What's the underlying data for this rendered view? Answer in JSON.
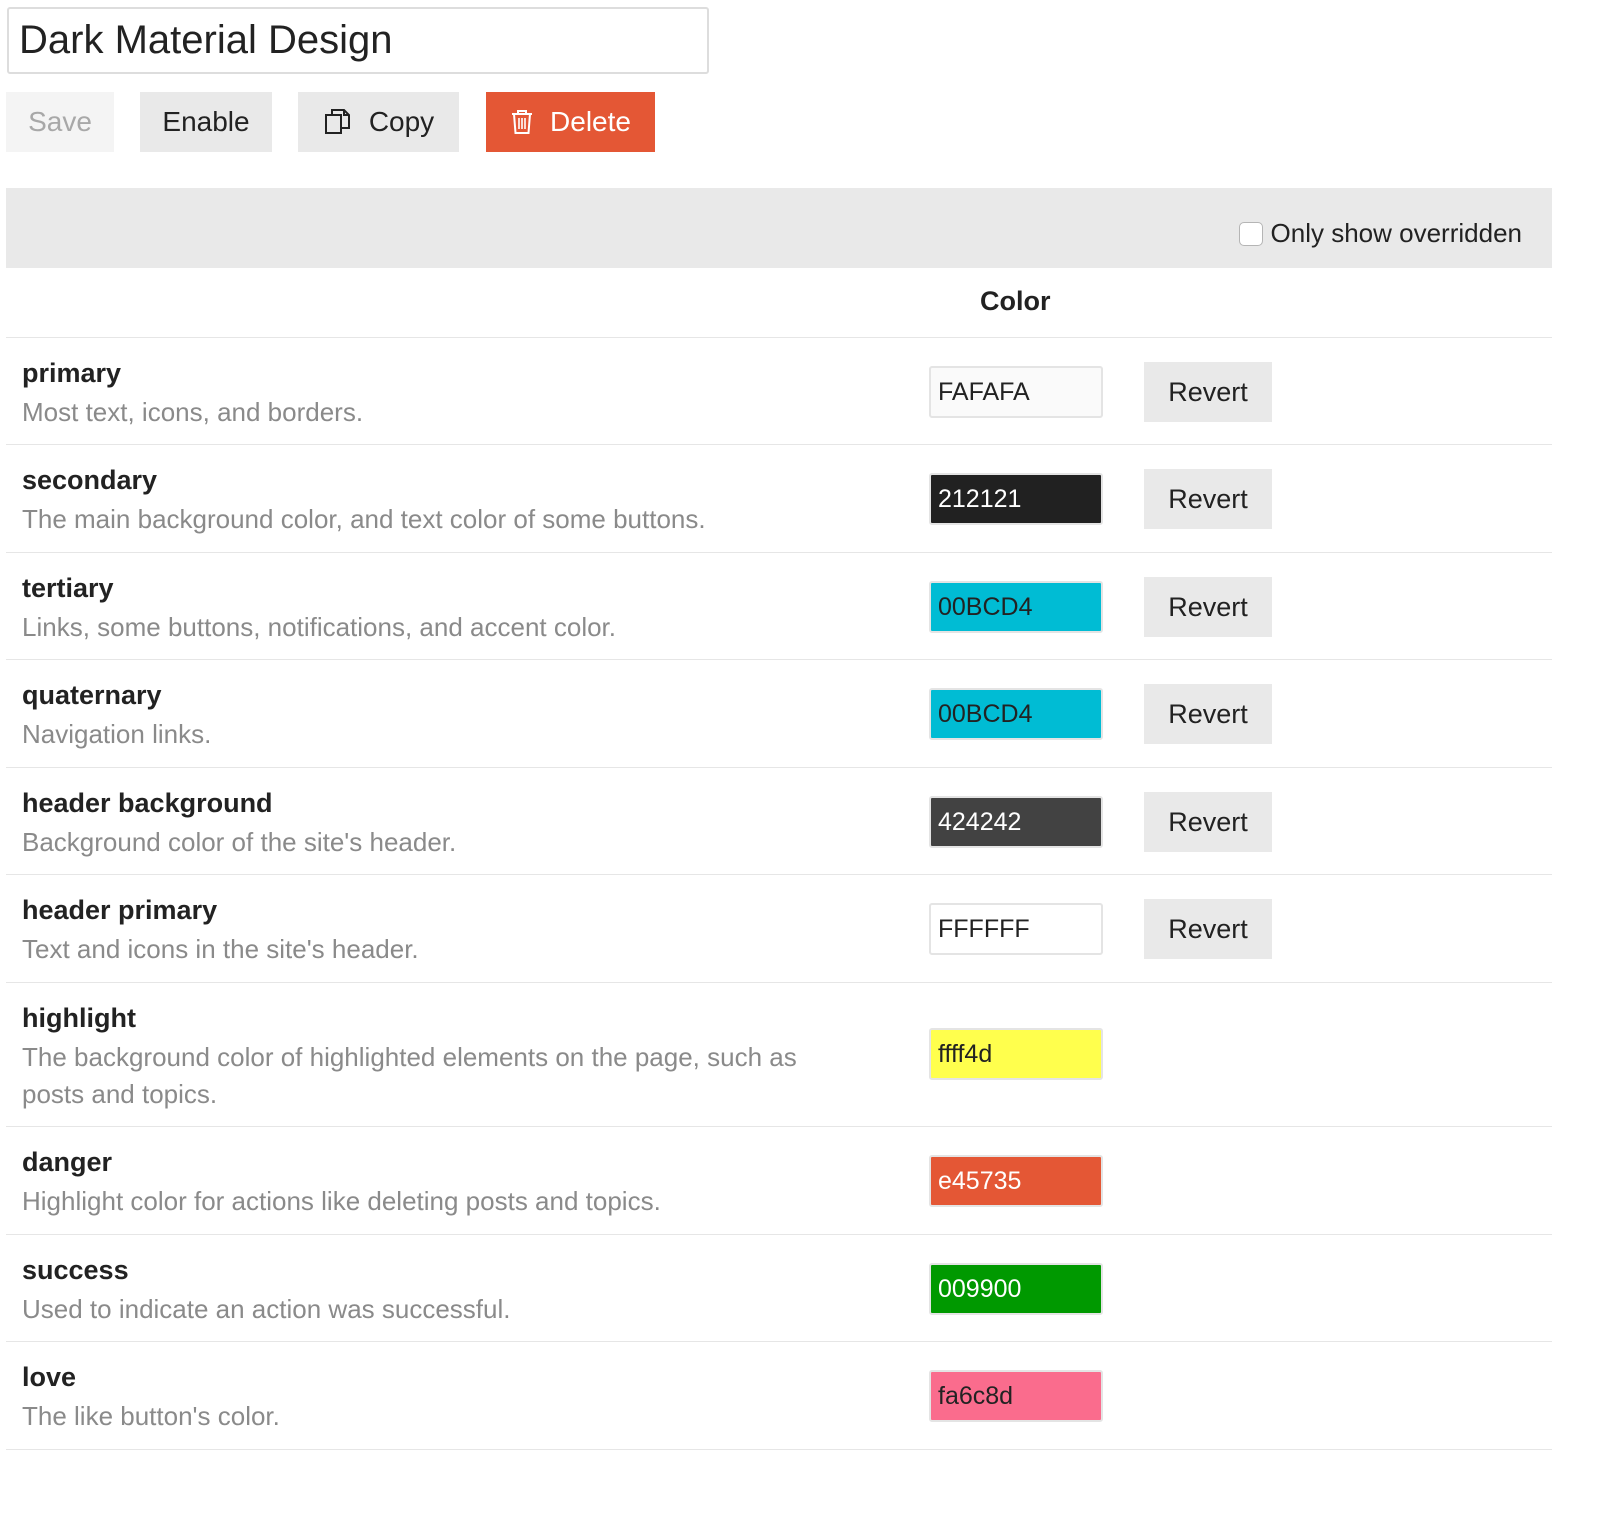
{
  "theme": {
    "name": "Dark Material Design"
  },
  "toolbar": {
    "save_label": "Save",
    "enable_label": "Enable",
    "copy_label": "Copy",
    "delete_label": "Delete"
  },
  "filter": {
    "only_overridden_label": "Only show overridden",
    "checked": false
  },
  "table": {
    "color_header": "Color",
    "revert_label": "Revert"
  },
  "colors": [
    {
      "name": "primary",
      "description": "Most text, icons, and borders.",
      "value": "FAFAFA",
      "bg": "#fafafa",
      "fg": "#222222",
      "revertable": true
    },
    {
      "name": "secondary",
      "description": "The main background color, and text color of some buttons.",
      "value": "212121",
      "bg": "#212121",
      "fg": "#ffffff",
      "revertable": true
    },
    {
      "name": "tertiary",
      "description": "Links, some buttons, notifications, and accent color.",
      "value": "00BCD4",
      "bg": "#00bcd4",
      "fg": "#222222",
      "revertable": true
    },
    {
      "name": "quaternary",
      "description": "Navigation links.",
      "value": "00BCD4",
      "bg": "#00bcd4",
      "fg": "#222222",
      "revertable": true
    },
    {
      "name": "header background",
      "description": "Background color of the site's header.",
      "value": "424242",
      "bg": "#424242",
      "fg": "#ffffff",
      "revertable": true
    },
    {
      "name": "header primary",
      "description": "Text and icons in the site's header.",
      "value": "FFFFFF",
      "bg": "#ffffff",
      "fg": "#222222",
      "revertable": true
    },
    {
      "name": "highlight",
      "description": "The background color of highlighted elements on the page, such as posts and topics.",
      "value": "ffff4d",
      "bg": "#ffff4d",
      "fg": "#222222",
      "revertable": false
    },
    {
      "name": "danger",
      "description": "Highlight color for actions like deleting posts and topics.",
      "value": "e45735",
      "bg": "#e45735",
      "fg": "#ffffff",
      "revertable": false
    },
    {
      "name": "success",
      "description": "Used to indicate an action was successful.",
      "value": "009900",
      "bg": "#009900",
      "fg": "#ffffff",
      "revertable": false
    },
    {
      "name": "love",
      "description": "The like button's color.",
      "value": "fa6c8d",
      "bg": "#fa6c8d",
      "fg": "#222222",
      "revertable": false
    }
  ],
  "icons": {
    "copy": "copy-icon",
    "delete": "trash-icon"
  },
  "accent_colors": {
    "danger_button": "#e45735",
    "button_gray": "#e9e9e9"
  }
}
